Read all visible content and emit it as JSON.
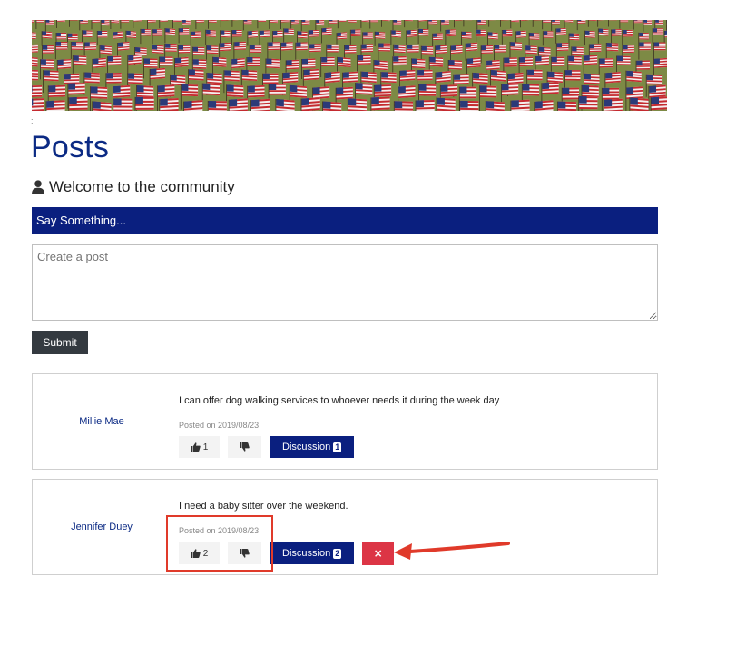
{
  "banner": {
    "image_name": "american-flags-banner"
  },
  "colors": {
    "brand_navy": "#0a1f7f",
    "title_blue": "#0b2a84",
    "submit_dark": "#343a40",
    "delete_red": "#dc3545",
    "annotation_red": "#e03a2a"
  },
  "page": {
    "mark": ":",
    "title": "Posts",
    "welcome": "Welcome to the community",
    "welcome_icon": "user-icon"
  },
  "composer": {
    "header": "Say Something...",
    "placeholder": "Create a post",
    "submit_label": "Submit"
  },
  "posts": [
    {
      "author": "Millie Mae",
      "text": "I can offer dog walking services to whoever needs it during the week day",
      "date": "Posted on 2019/08/23",
      "likes": "1",
      "discussion_label": "Discussion",
      "discussion_count": "1"
    },
    {
      "author": "Jennifer Duey",
      "text": "I need a baby sitter over the weekend.",
      "date": "Posted on 2019/08/23",
      "likes": "2",
      "discussion_label": "Discussion",
      "discussion_count": "2",
      "delete_label": "×"
    }
  ],
  "icons": {
    "like": "thumbs-up-icon",
    "dislike": "thumbs-down-icon"
  }
}
